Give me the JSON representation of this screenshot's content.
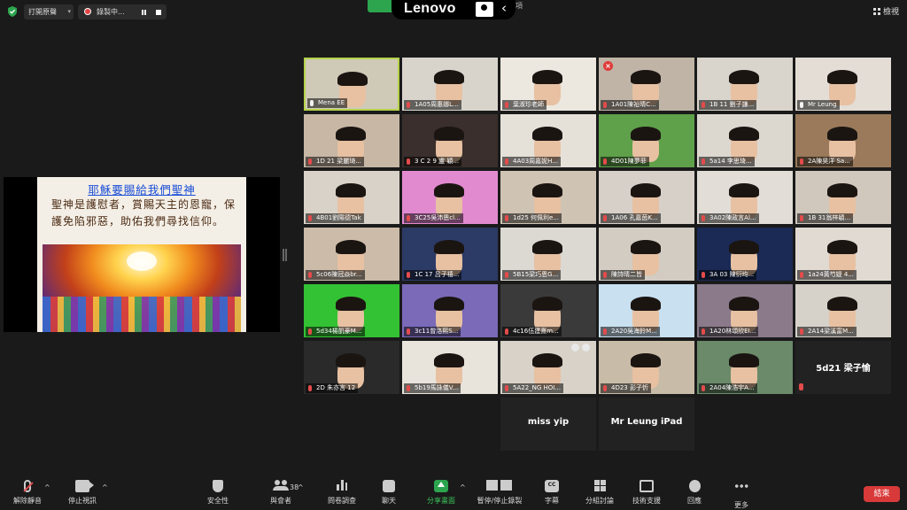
{
  "topbar": {
    "open_original": "打開原聲",
    "recording": "錄製中...",
    "brand": "Lenovo",
    "ghost_menu": "項",
    "view": "檢視"
  },
  "shared_screen": {
    "slide_title": "耶穌要賜給我們聖神",
    "slide_body": "聖神是護慰者，賞賜天主的恩寵，保護免陷邪惡，助佑我們尋找信仰。"
  },
  "gallery": {
    "tiles": [
      {
        "label": "Mena EE"
      },
      {
        "label": "1A05周惠娜L..."
      },
      {
        "label": "葉淑珍老師"
      },
      {
        "label": "1A01陳祉晴C..."
      },
      {
        "label": "1B 11 劉子謙..."
      },
      {
        "label": "Mr Leung"
      },
      {
        "label": "1D 21 梁麗琦..."
      },
      {
        "label": "3 C 2 9 盧 穎..."
      },
      {
        "label": "4A03周嘉妮H..."
      },
      {
        "label": "4D01陳夢菲"
      },
      {
        "label": "5a14 李思琦..."
      },
      {
        "label": "2A陳昊洋 Sa..."
      },
      {
        "label": "4B01劉陽德Tak"
      },
      {
        "label": "3C25吳沛恩cl..."
      },
      {
        "label": "1d25 何佩利e..."
      },
      {
        "label": "1A06 孔嘉茵K..."
      },
      {
        "label": "3A02陳政言Al..."
      },
      {
        "label": "1B 31翁梓穎..."
      },
      {
        "label": "5c06陳冠焱br..."
      },
      {
        "label": "1C 17 呂子禧..."
      },
      {
        "label": "5B15梁巧恩G..."
      },
      {
        "label": "陳詩晴二皆"
      },
      {
        "label": "3A 03 陳衍均..."
      },
      {
        "label": "1a24黃芍媞 4..."
      },
      {
        "label": "5d34楊凱豪M..."
      },
      {
        "label": "3c11曾洛熙S..."
      },
      {
        "label": "4c16伍建熹m..."
      },
      {
        "label": "2A20吳海鈴M..."
      },
      {
        "label": "1A20林頌欣EI..."
      },
      {
        "label": "2A14梁溪富M..."
      },
      {
        "label": "2D 朱亦言 12"
      },
      {
        "label": "5b19馬詠儀V..."
      },
      {
        "label": "5A22_NG HOI..."
      },
      {
        "label": "4D23 彭子忻"
      },
      {
        "label": "2A04陳浩宇A..."
      },
      {
        "label": "5d21 梁子愉"
      },
      {
        "label": "miss yip"
      },
      {
        "label": "Mr Leung iPad"
      }
    ]
  },
  "toolbar": {
    "unmute": "解除靜音",
    "stop_video": "停止視訊",
    "security": "安全性",
    "participants": "與會者",
    "participants_count": "38",
    "polls": "問卷調查",
    "chat": "聊天",
    "share_screen": "分享畫面",
    "pause_stop_record": "暫停/停止錄製",
    "captions": "字幕",
    "breakout_rooms": "分組討論",
    "tech_support": "技術支援",
    "reactions": "回應",
    "more": "更多",
    "end": "結束"
  }
}
